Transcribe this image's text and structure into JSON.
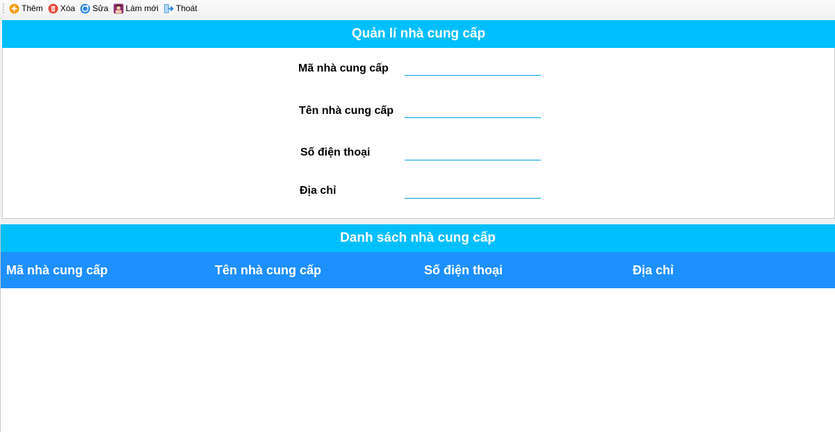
{
  "toolbar": {
    "items": [
      {
        "label": "Thêm",
        "icon": "add-icon"
      },
      {
        "label": "Xóa",
        "icon": "trash-icon"
      },
      {
        "label": "Sửa",
        "icon": "edit-icon"
      },
      {
        "label": "Làm mới",
        "icon": "refresh-icon"
      },
      {
        "label": "Thoát",
        "icon": "exit-icon"
      }
    ]
  },
  "form": {
    "title": "Quản lí nhà cung cấp",
    "fields": [
      {
        "label": "Mã nhà cung cấp",
        "value": ""
      },
      {
        "label": "Tên nhà cung cấp",
        "value": ""
      },
      {
        "label": "Số điện thoại",
        "value": ""
      },
      {
        "label": "Địa chỉ",
        "value": ""
      }
    ]
  },
  "list": {
    "title": "Danh sách nhà cung cấp",
    "columns": [
      "Mã nhà cung cấp",
      "Tên nhà cung cấp",
      "Số điện thoại",
      "Địa chỉ"
    ],
    "rows": []
  },
  "colors": {
    "title_bar": "#00bfff",
    "grid_header": "#1e90ff",
    "input_underline": "#00a0e8"
  }
}
